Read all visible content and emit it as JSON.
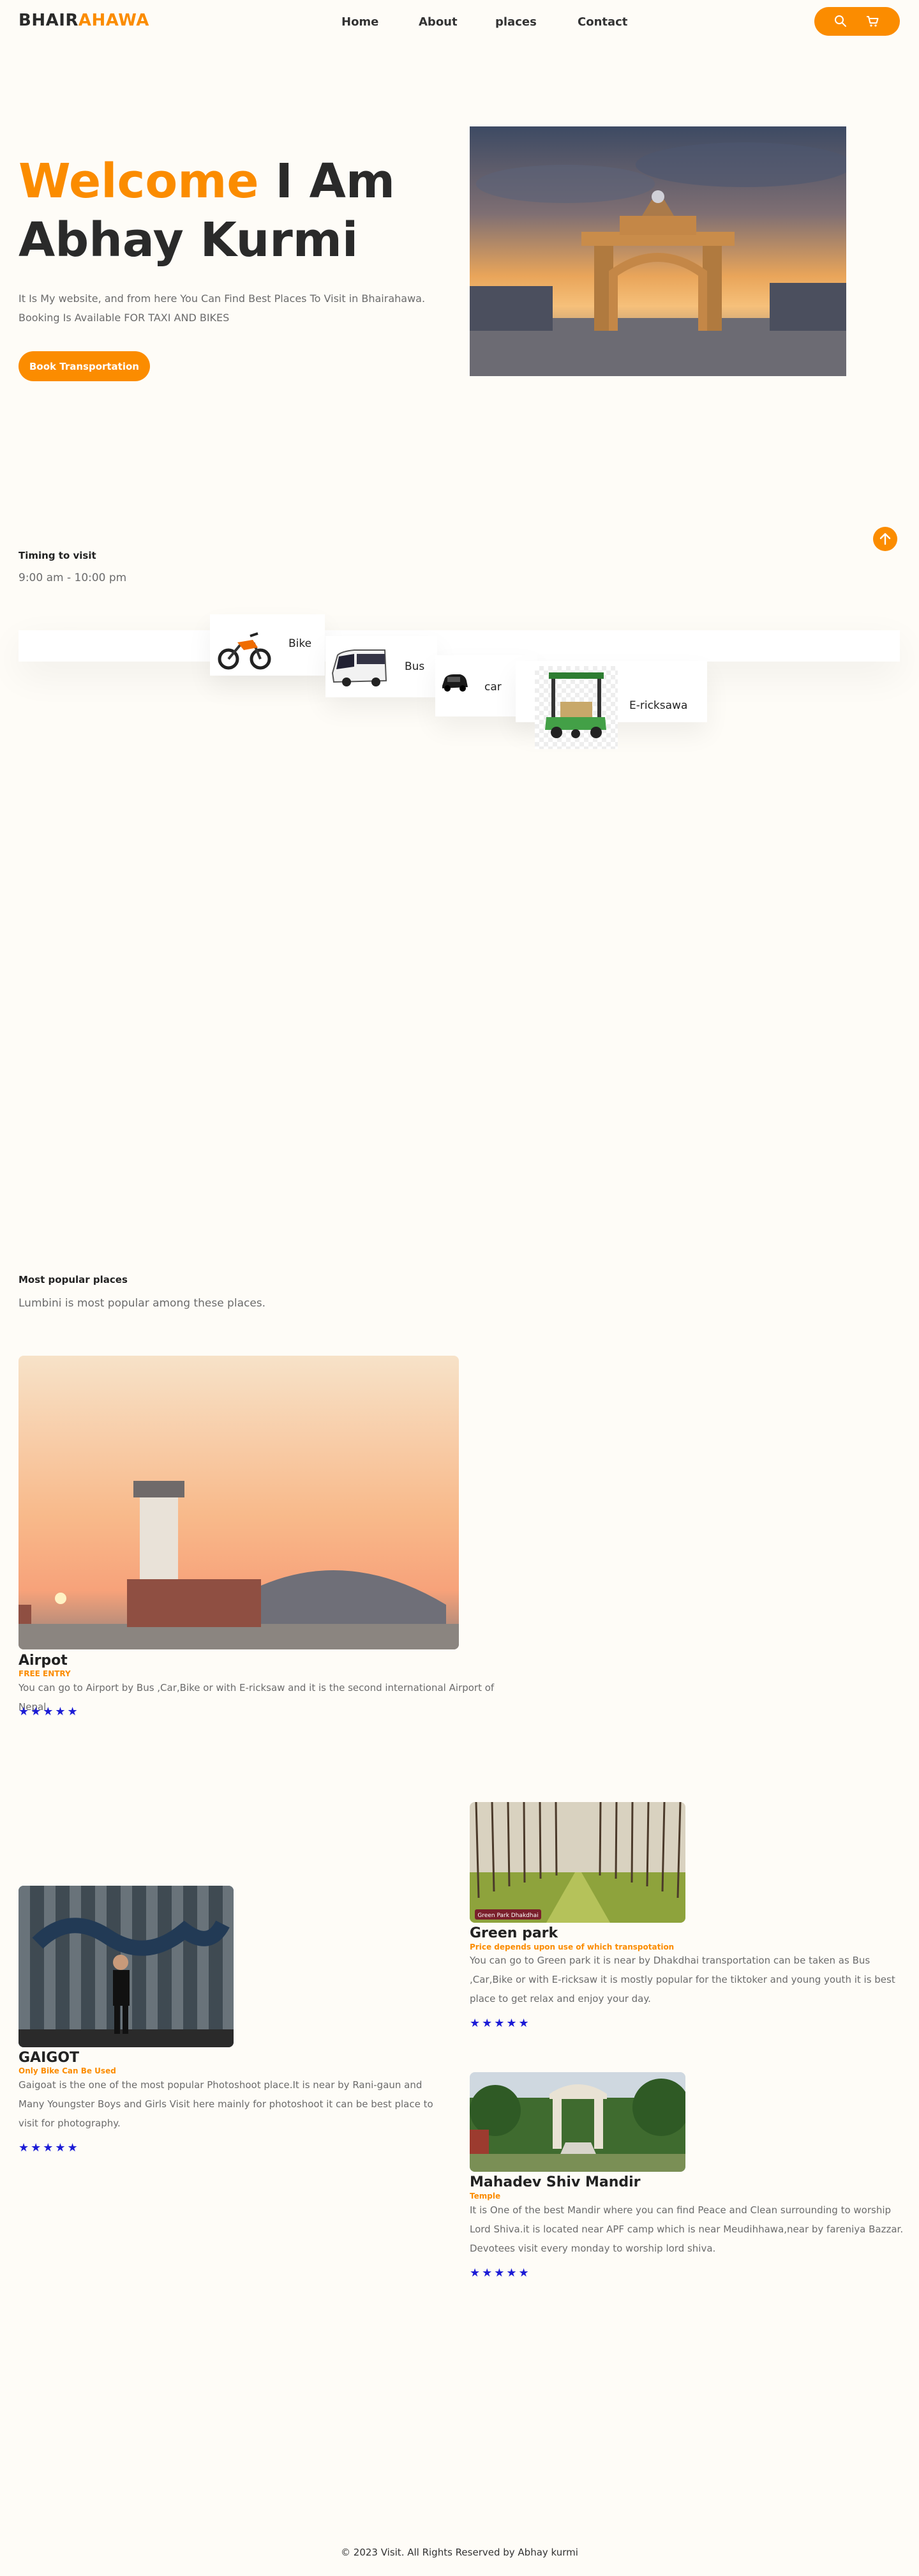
{
  "header": {
    "logo_part1": "BHAIR",
    "logo_part2": "AHAWA",
    "nav": [
      "Home",
      "About",
      "places",
      "Contact"
    ],
    "search_icon": "search-icon",
    "cart_icon": "cart-icon"
  },
  "hero": {
    "title_highlight": "Welcome",
    "title_rest1": "I Am",
    "title_rest2": "Abhay Kurmi",
    "description": "It Is My website, and from here You Can Find Best Places To Visit in Bhairahawa. Booking Is Available FOR TAXI AND BIKES",
    "button": "Book Transportation"
  },
  "timing": {
    "title": "Timing to visit",
    "hours": "9:00 am - 10:00 pm"
  },
  "transport": [
    "Bike",
    "Bus",
    "car",
    "E-ricksawa"
  ],
  "popular": {
    "title": "Most popular places",
    "subtitle": "Lumbini is most popular among these places."
  },
  "places": [
    {
      "name": "Airpot",
      "tag": "FREE ENTRY",
      "desc": "You can go to Airport by Bus ,Car,Bike or with E-ricksaw and it is the second international Airport of Nepal.",
      "stars": "★★★★★"
    },
    {
      "name": "Green park",
      "tag": "Price depends upon use of which transpotation",
      "desc": "You can go to Green park it is near by Dhakdhai transportation can be taken as Bus ,Car,Bike or with E-ricksaw it is mostly popular for the tiktoker and young youth it is best place to get relax and enjoy your day.",
      "stars": "★★★★★",
      "img_caption": "Green Park Dhakdhai"
    },
    {
      "name": "GAIGOT",
      "tag": "Only Bike Can Be Used",
      "desc": "Gaigoat is the one of the most popular Photoshoot place.It is near by Rani-gaun and Many Youngster Boys and Girls Visit here mainly for photoshoot it can be best place to visit for photography.",
      "stars": "★★★★★"
    },
    {
      "name": "Mahadev Shiv Mandir",
      "tag": "Temple",
      "desc": "It is One of the best Mandir where you can find Peace and Clean surrounding to worship Lord Shiva.it is located near APF camp which is near Meudihhawa,near by fareniya Bazzar. Devotees visit every monday to worship lord shiva.",
      "stars": "★★★★★"
    }
  ],
  "footer": "© 2023 Visit. All Rights Reserved by Abhay kurmi"
}
